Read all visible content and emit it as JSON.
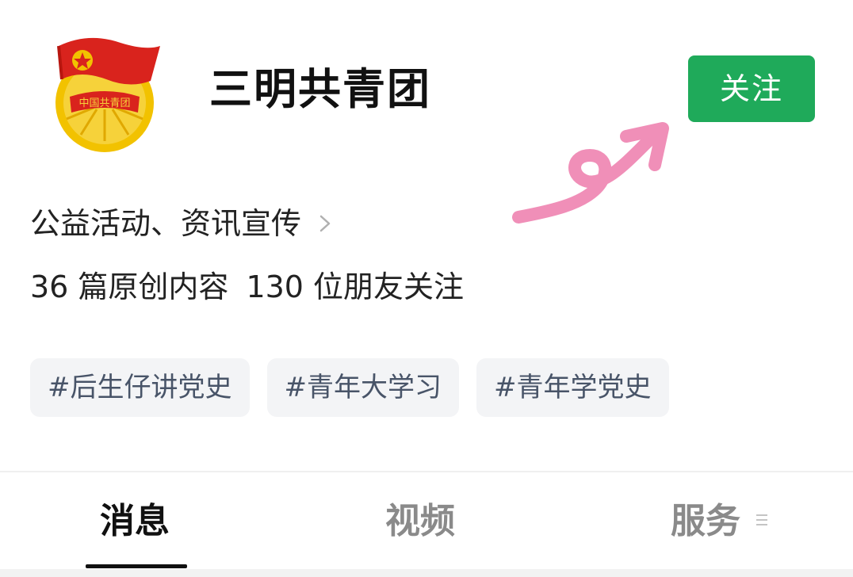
{
  "account": {
    "name": "三明共青团",
    "follow_label": "关注",
    "intro": "公益活动、资讯宣传",
    "stats": {
      "original_count": "36 篇原创内容",
      "followers": "130 位朋友关注"
    },
    "tags": [
      "#后生仔讲党史",
      "#青年大学习",
      "#青年学党史"
    ],
    "avatar_icon": "communist-youth-league-emblem-icon"
  },
  "tabs": [
    {
      "label": "消息",
      "active": true
    },
    {
      "label": "视频",
      "active": false
    },
    {
      "label": "服务",
      "active": false
    }
  ],
  "colors": {
    "follow_button": "#1faa5a",
    "tag_bg": "#f3f4f6",
    "tag_text": "#485468",
    "annotation_arrow": "#f08fb8",
    "emblem_red": "#d9231d",
    "emblem_gold": "#f2c200"
  }
}
